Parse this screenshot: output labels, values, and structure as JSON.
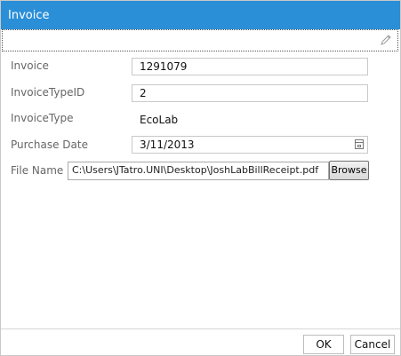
{
  "dialog": {
    "title": "Invoice",
    "icons": {
      "edit": "pencil-icon",
      "date": "calendar-icon"
    }
  },
  "form": {
    "invoice_label": "Invoice",
    "invoice_value": "1291079",
    "invoice_type_id_label": "InvoiceTypeID",
    "invoice_type_id_value": "2",
    "invoice_type_label": "InvoiceType",
    "invoice_type_value": "EcoLab",
    "purchase_date_label": "Purchase Date",
    "purchase_date_value": "3/11/2013",
    "file_name_label": "File Name",
    "file_name_value": "C:\\Users\\JTatro.UNI\\Desktop\\JoshLabBillReceipt.pdf",
    "browse_label": "Browse"
  },
  "footer": {
    "ok_label": "OK",
    "cancel_label": "Cancel"
  },
  "colors": {
    "titlebar": "#2b8fd8",
    "label": "#666666"
  }
}
